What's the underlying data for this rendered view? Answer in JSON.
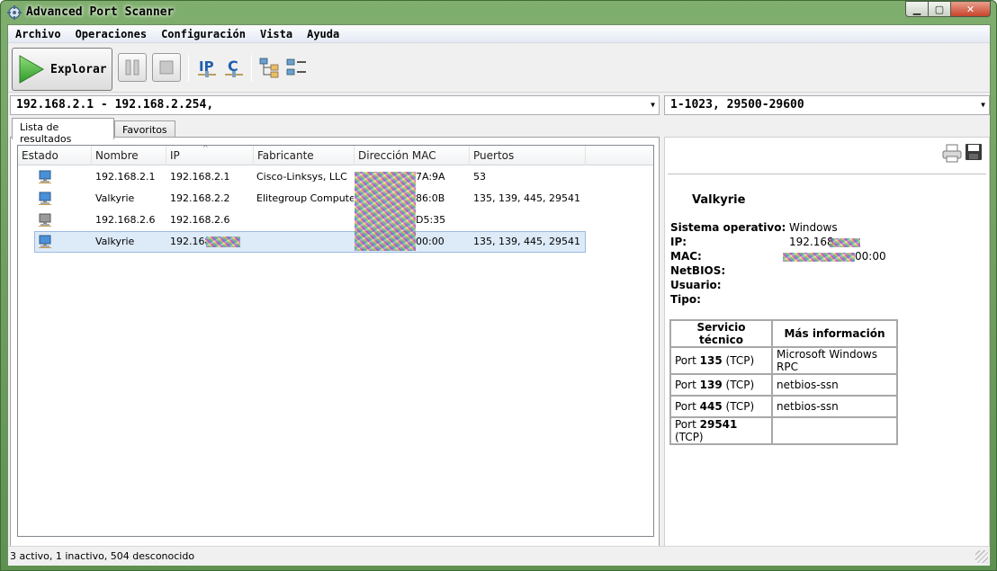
{
  "window": {
    "title": "Advanced Port Scanner"
  },
  "menu": [
    "Archivo",
    "Operaciones",
    "Configuración",
    "Vista",
    "Ayuda"
  ],
  "toolbar": {
    "scan_label": "Explorar"
  },
  "range": {
    "ip_range": "192.168.2.1 - 192.168.2.254,",
    "ports": "1-1023, 29500-29600"
  },
  "tabs": [
    "Lista de resultados",
    "Favoritos"
  ],
  "columns": [
    "Estado",
    "Nombre",
    "IP",
    "Fabricante",
    "Dirección MAC",
    "Puertos"
  ],
  "rows": [
    {
      "name": "192.168.2.1",
      "ip": "192.168.2.1",
      "vendor": "Cisco-Linksys, LLC",
      "mac": "7A:9A",
      "ports": "53"
    },
    {
      "name": "Valkyrie",
      "ip": "192.168.2.2",
      "vendor": "Elitegroup Compute…",
      "mac": "86:0B",
      "ports": "135, 139, 445, 29541"
    },
    {
      "name": "192.168.2.6",
      "ip": "192.168.2.6",
      "vendor": "",
      "mac": "D5:35",
      "ports": ""
    },
    {
      "name": "Valkyrie",
      "ip": "192.168",
      "vendor": "",
      "mac": "00:00",
      "ports": "135, 139, 445, 29541"
    }
  ],
  "details": {
    "host": "Valkyrie",
    "fields": [
      {
        "label": "Sistema operativo:",
        "value": "Windows"
      },
      {
        "label": "IP:",
        "value": "192.168"
      },
      {
        "label": "MAC:",
        "value": "00:00"
      },
      {
        "label": "NetBIOS:",
        "value": ""
      },
      {
        "label": "Usuario:",
        "value": ""
      },
      {
        "label": "Tipo:",
        "value": ""
      }
    ],
    "table_headers": [
      "Servicio técnico",
      "Más información"
    ],
    "services": [
      {
        "prefix": "Port",
        "port": "135",
        "proto": "(TCP)",
        "info": "Microsoft Windows RPC"
      },
      {
        "prefix": "Port",
        "port": "139",
        "proto": "(TCP)",
        "info": "netbios-ssn"
      },
      {
        "prefix": "Port",
        "port": "445",
        "proto": "(TCP)",
        "info": "netbios-ssn"
      },
      {
        "prefix": "Port",
        "port": "29541",
        "proto": "(TCP)",
        "info": ""
      }
    ]
  },
  "status": "3 activo, 1 inactivo, 504 desconocido"
}
